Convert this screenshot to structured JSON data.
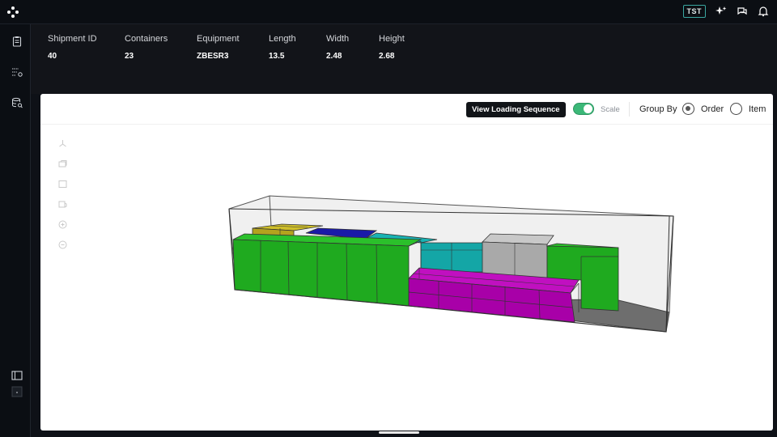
{
  "topbar": {
    "env_badge": "TST",
    "icons": [
      "app-logo-icon",
      "sparkle-icon",
      "chat-icon",
      "bell-icon"
    ]
  },
  "sidebar": {
    "icons": [
      "clipboard-icon",
      "list-settings-icon",
      "database-search-icon",
      "panel-toggle-icon",
      "collapse-icon"
    ]
  },
  "shipment": {
    "fields": [
      {
        "label": "Shipment ID",
        "value": "40"
      },
      {
        "label": "Containers",
        "value": "23"
      },
      {
        "label": "Equipment",
        "value": "ZBESR3"
      },
      {
        "label": "Length",
        "value": "13.5"
      },
      {
        "label": "Width",
        "value": "2.48"
      },
      {
        "label": "Height",
        "value": "2.68"
      }
    ]
  },
  "toolbar": {
    "view_sequence_label": "View Loading Sequence",
    "scale_label": "Scale",
    "scale_enabled": true,
    "group_by_label": "Group By",
    "options": [
      {
        "label": "Order",
        "selected": true
      },
      {
        "label": "Item",
        "selected": false
      }
    ]
  },
  "view_tools": [
    "axes-icon",
    "perspective-icon",
    "front-view-icon",
    "side-view-icon",
    "zoom-in-icon",
    "zoom-out-icon"
  ],
  "colors": {
    "green": "#1faa1f",
    "olive": "#b3a31e",
    "blue": "#1a1aa8",
    "teal": "#14a6a6",
    "gray": "#a9a9a9",
    "magenta": "#a800a8",
    "floor": "#6e6e6e",
    "toggle_on": "#3cb878"
  }
}
